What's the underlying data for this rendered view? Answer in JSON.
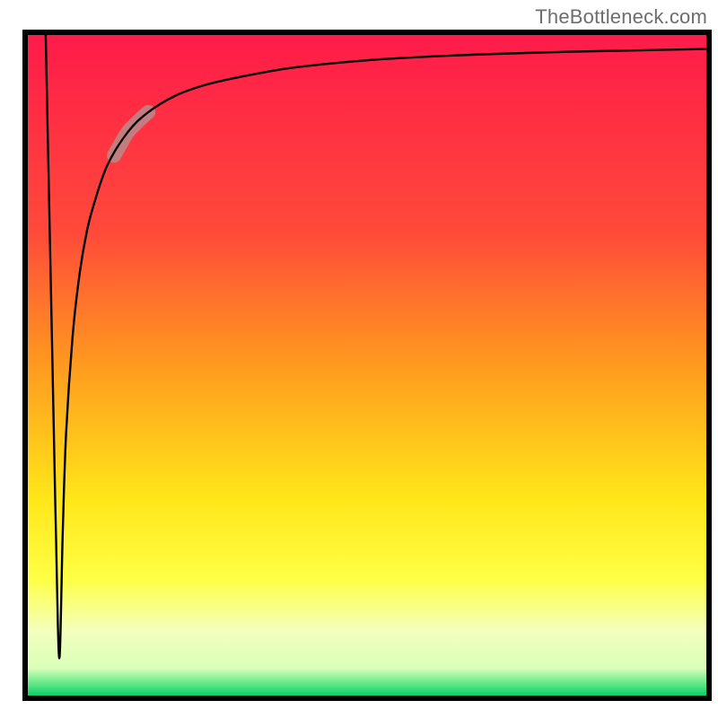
{
  "attribution": "TheBottleneck.com",
  "chart_data": {
    "type": "line",
    "title": "",
    "xlabel": "",
    "ylabel": "",
    "xlim": [
      0,
      100
    ],
    "ylim": [
      0,
      100
    ],
    "axes_visible": false,
    "grid": false,
    "legend": false,
    "background_gradient": {
      "stops": [
        {
          "pos": 0.0,
          "color": "#ff1a4a"
        },
        {
          "pos": 0.3,
          "color": "#ff4a3a"
        },
        {
          "pos": 0.5,
          "color": "#ff9a1f"
        },
        {
          "pos": 0.7,
          "color": "#ffe61a"
        },
        {
          "pos": 0.82,
          "color": "#ffff44"
        },
        {
          "pos": 0.9,
          "color": "#f3ffbe"
        },
        {
          "pos": 0.955,
          "color": "#d9ffb8"
        },
        {
          "pos": 0.985,
          "color": "#3ee07a"
        },
        {
          "pos": 1.0,
          "color": "#00c46a"
        }
      ]
    },
    "frame_color": "#000000",
    "series": [
      {
        "name": "bottleneck-curve",
        "color": "#000000",
        "width": 2.4,
        "x": [
          3.0,
          4.0,
          4.5,
          5.0,
          5.5,
          6.0,
          7.0,
          8.0,
          9.0,
          10.0,
          12.0,
          15.0,
          18.0,
          22.0,
          26.0,
          30.0,
          35.0,
          40.0,
          50.0,
          60.0,
          70.0,
          80.0,
          90.0,
          100.0
        ],
        "values": [
          100.0,
          50.0,
          25.0,
          6.0,
          25.0,
          40.0,
          55.0,
          64.0,
          70.0,
          74.0,
          80.0,
          85.0,
          88.0,
          90.5,
          92.0,
          93.0,
          94.0,
          94.8,
          95.8,
          96.4,
          96.8,
          97.1,
          97.3,
          97.5
        ]
      }
    ],
    "highlight_segment": {
      "series": "bottleneck-curve",
      "color": "#b88a8a",
      "opacity": 0.85,
      "width": 16,
      "x": [
        13.0,
        14.0,
        15.0,
        16.0,
        17.0,
        18.0
      ],
      "values": [
        81.5,
        83.3,
        85.0,
        86.1,
        87.1,
        88.0
      ]
    }
  }
}
